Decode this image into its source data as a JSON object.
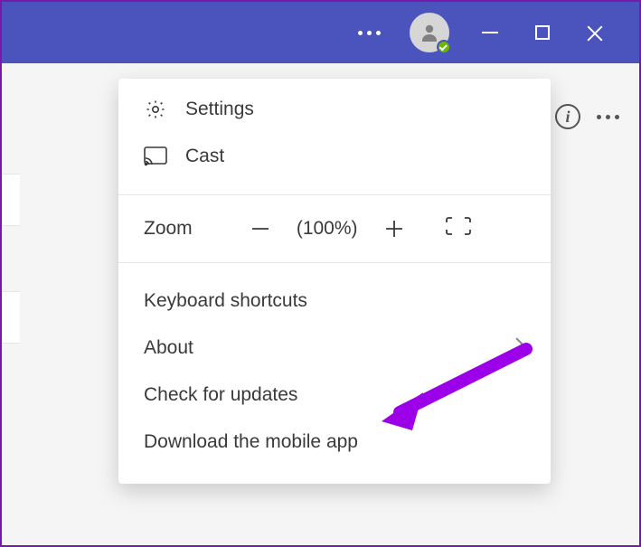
{
  "menu": {
    "settings": "Settings",
    "cast": "Cast",
    "zoom_label": "Zoom",
    "zoom_pct": "(100%)",
    "keyboard_shortcuts": "Keyboard shortcuts",
    "about": "About",
    "check_updates": "Check for updates",
    "download_app": "Download the mobile app"
  },
  "info_glyph": "i"
}
